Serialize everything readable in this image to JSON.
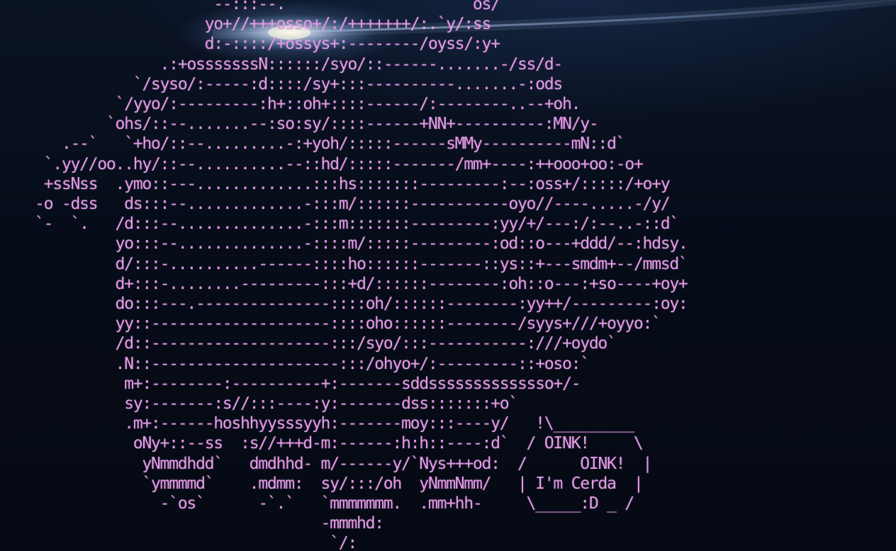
{
  "colors": {
    "text": "#e49ae6",
    "background": "#050b16",
    "glow": "#bcd3f5"
  },
  "terminal": {
    "ascii_art": "                   `--:::--.                    `os/\n                   yo+//+++osso+/:/+++++++/:.`y/:ss\n                   d:-::::/+ossys+:--------/oyss/:y+\n              .:+osssssssN::::::/syo/::------.......-/ss/d-\n           `/syso/:-----:d::::/sy+:::----------.......-:ods\n         `/yyo/:---------:h+::oh+::::------/:--------..--+oh.\n        `ohs/::--.......--:so:sy/::::------+NN+----------:MN/y-\n   .--`   `+ho/::--.........-:+yoh/:::::------sMMy----------mN::d`\n `.yy//oo..hy/::--..........--::hd/:::::-------/mm+----:++ooo+oo:-o+\n +ssNss  .ymo::---.............:::hs:::::::---------:--:oss+/:::::/+o+y\n-o -dss   ds:::--.............-:::m/::::::-----------oyo//----.....-/y/\n`-  `.   /d:::--..............-:::m:::::::---------:yy/+/---:/:--..-::d`\n         yo:::--..............-::::m/:::::---------:od::o---+ddd/--:hdsy.\n         d/:::-..........------::::ho::::::-------::ys::+---smdm+--/mmsd`\n         d+:::-........---------:::+d/::::::--------:oh::o---:+so----+oy+\n         do:::---.---------------::::oh/::::::--------:yy++/---------:oy:\n         yy::--------------------::::oho::::::--------/syys+///+oyyo:`\n         /d::--------------------:::/syo/:::-----------:///+oydo`\n         .N::---------------------:::/ohyo+/:---------::+oso:`\n          m+:--------:----------+:-------sddssssssssssssso+/-\n          sy:-------:s//:::----:y:-------dss:::::::+o`\n          .m+:------hoshhyysssyyh:-------moy:::----y/   !\\_________\n           oNy+::--ss  :s//+++d-m:------:h:h::----:d`  / OINK!     \\\n            yNmmdhdd`   dmdhhd- m/------y/`Nys+++od:  /      OINK!  |\n            `ymmmmd`    .mdmm:  sy/:::/oh  yNmmNmm/   | I'm Cerda  |\n              -`os`      -`.`   `mmmmmmm.  .mm+hh-     \\_____:D _ /\n                                -mmmhd:\n                                 `/:"
  }
}
